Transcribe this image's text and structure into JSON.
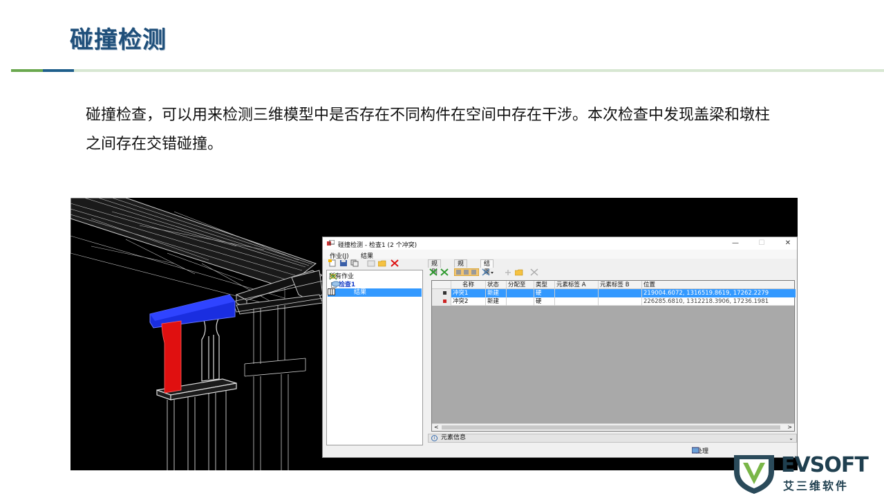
{
  "slide": {
    "title": "碰撞检测",
    "body": "碰撞检查，可以用来检测三维模型中是否存在不同构件在空间中存在干涉。本次检查中发现盖梁和墩柱之间存在交错碰撞。"
  },
  "dialog": {
    "title": "碰撞检测 - 检查1 (2 个冲突)",
    "window_buttons": {
      "minimize": "—",
      "maximize": "☐",
      "close": "✕"
    },
    "menu": [
      "作业(J)",
      "结果"
    ],
    "tree": {
      "root": "所有作业",
      "job": "检查1",
      "result": "结果"
    },
    "tabs": [
      "规则",
      "规则",
      "结果"
    ],
    "grid": {
      "columns": [
        "",
        "名称",
        "状态",
        "分配至",
        "类型",
        "元素标签 A",
        "元素标签 B",
        "位置"
      ],
      "rows": [
        {
          "name": "冲突1",
          "status": "新建",
          "assigned": "",
          "type": "硬",
          "tag_a": "",
          "tag_b": "",
          "position": "219004.6072, 1316519.8619, 17262.2279"
        },
        {
          "name": "冲突2",
          "status": "新建",
          "assigned": "",
          "type": "硬",
          "tag_a": "",
          "tag_b": "",
          "position": "226285.6810, 1312218.3906, 17236.1981"
        }
      ],
      "scroll_left": "<",
      "scroll_right": ">"
    },
    "info_label": "元素信息",
    "info_icon": "i",
    "process_button": "处理"
  },
  "logo": {
    "brand": "EVSOFT",
    "subtitle": "艾三维软件"
  },
  "colors": {
    "title": "#1f4f7a",
    "rule_green": "#6aa84f",
    "rule_blue": "#1f5f8b",
    "selection": "#3399ff",
    "clash_red": "#e01010",
    "clash_blue": "#1a2ee0"
  }
}
